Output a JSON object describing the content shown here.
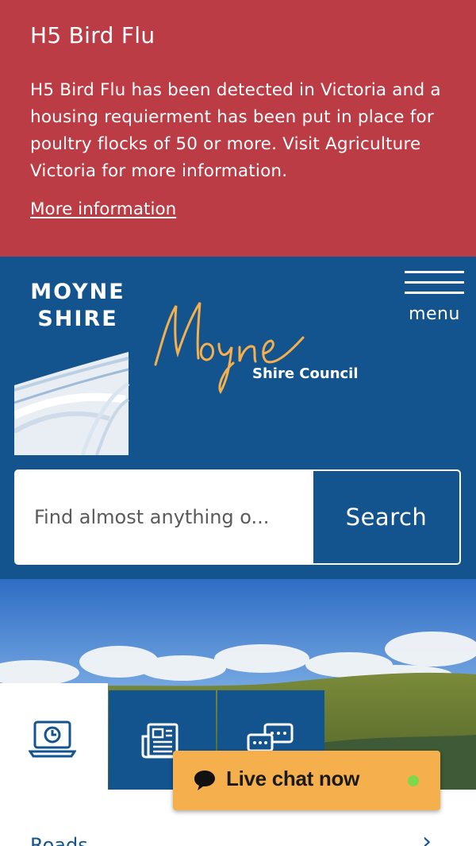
{
  "alert": {
    "title": "H5 Bird Flu",
    "body": "H5 Bird Flu has been detected in Victoria and a housing requierment has been put in place for poultry flocks of 50 or more. Visit Agriculture Victoria for more information.",
    "link": "More information",
    "color": "#bc3c46"
  },
  "header": {
    "logo_line1": "MOYNE",
    "logo_line2": "SHIRE",
    "script_logo": "Moyne",
    "script_sub": "Shire Council",
    "menu_label": "menu",
    "color": "#13548f",
    "accent": "#f5b04d"
  },
  "search": {
    "placeholder": "Find almost anything o...",
    "button": "Search"
  },
  "quick_tabs": [
    {
      "icon": "laptop-clock-icon",
      "active": true
    },
    {
      "icon": "newspaper-icon",
      "active": false
    },
    {
      "icon": "chat-bubbles-icon",
      "active": false
    }
  ],
  "content": {
    "first_item": "Roads",
    "chevron": "›"
  },
  "livechat": {
    "label": "Live chat now",
    "status_color": "#7fd84a"
  }
}
